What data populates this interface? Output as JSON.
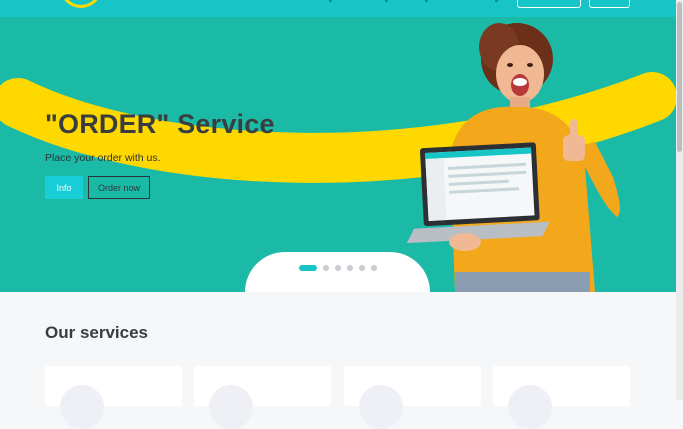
{
  "hero": {
    "title": "\"ORDER\" Service",
    "subtitle": "Place your order with us.",
    "info_label": "Info",
    "order_label": "Order now",
    "slides_total": 6,
    "slide_active": 1
  },
  "services": {
    "title": "Our services",
    "card_count": 4
  },
  "colors": {
    "brand_teal": "#17c5c7",
    "hero_bg": "#1bbaa7",
    "accent_yellow": "#ffd800",
    "sweater": "#f3a81c"
  },
  "icons": {
    "logo": "logo-arc",
    "card1": "document-icon",
    "card2": "globe-icon",
    "card3": "location-icon",
    "card4": "clock-icon"
  }
}
